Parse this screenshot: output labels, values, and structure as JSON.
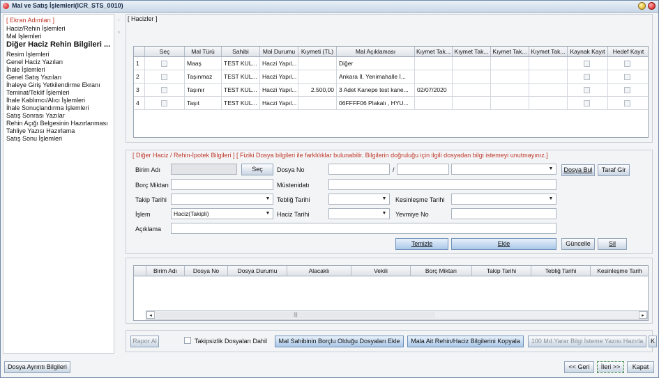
{
  "window": {
    "title": "Mal ve Satış İşlemleri(ICR_STS_0010)"
  },
  "sidebar": {
    "header": "[ Ekran Adımları ]",
    "items": [
      {
        "label": "Haciz/Rehin İşlemleri"
      },
      {
        "label": "Mal İşlemleri"
      },
      {
        "label": "Diğer Haciz Rehin Bilgileri ..."
      },
      {
        "label": "Resim İşlemleri"
      },
      {
        "label": "Genel Haciz Yazıları"
      },
      {
        "label": "İhale İşlemleri"
      },
      {
        "label": "Genel Satış Yazıları"
      },
      {
        "label": "İhaleye Giriş Yetkilendirme Ekranı"
      },
      {
        "label": "Teminat/Teklif İşlemleri"
      },
      {
        "label": "İhale Kablımcı/Alıcı İşlemleri"
      },
      {
        "label": "İhale Sonuçlandırma İşlemleri"
      },
      {
        "label": "Satış Sonrası Yazılar"
      },
      {
        "label": "Rehin Açığı Belgesinin Hazırlanması"
      },
      {
        "label": "Tahliye Yazısı Hazırlama"
      },
      {
        "label": "Satış Sonu İşlemleri"
      }
    ]
  },
  "hacizler": {
    "group_label": "[ Hacizler ]",
    "columns": [
      "",
      "Seç",
      "Mal Türü",
      "Sahibi",
      "Mal Durumu",
      "Kıymeti (TL)",
      "Mal Açıklaması",
      "Kıymet Tak...",
      "Kıymet Tak...",
      "Kıymet Tak...",
      "Kıymet Tak...",
      "Kaynak Kayıt",
      "Hedef Kayıt"
    ],
    "rows": [
      {
        "no": "1",
        "mal_turu": "Maaş",
        "sahibi": "TEST KUL...",
        "mal_durumu": "Haczi Yapıl...",
        "kiymeti": "",
        "aciklama": "Diğer",
        "kt1": ""
      },
      {
        "no": "2",
        "mal_turu": "Taşınmaz",
        "sahibi": "TEST KUL...",
        "mal_durumu": "Haczi Yapıl...",
        "kiymeti": "",
        "aciklama": "Ankara İl, Yenimahalle İ...",
        "kt1": ""
      },
      {
        "no": "3",
        "mal_turu": "Taşınır",
        "sahibi": "TEST KUL...",
        "mal_durumu": "Haczi Yapıl...",
        "kiymeti": "2.500,00",
        "aciklama": "3 Adet Kanepe test kane...",
        "kt1": "02/07/2020"
      },
      {
        "no": "4",
        "mal_turu": "Taşıt",
        "sahibi": "TEST KUL...",
        "mal_durumu": "Haczi Yapıl...",
        "kiymeti": "",
        "aciklama": "06FFFF06 Plakalı , HYU...",
        "kt1": ""
      }
    ]
  },
  "diger_haciz": {
    "group_label": "[ Diğer Haciz / Rehin-İpotek Bilgileri ] [ Fiziki Dosya bilgileri ile farklılıklar bulunabilir. Bilgilerin doğruluğu için ilgili dosyadan bilgi istemeyi unutmayınız.]",
    "birim_adi_label": "Birim Adı",
    "birim_adi_value": "",
    "sec_button": "Seç",
    "dosya_no_label": "Dosya No",
    "dosya_no_value": "",
    "dosya_no_sep": "/",
    "dosya_no_value2": "",
    "dosya_tur_value": "",
    "dosya_bul_button": "Dosya Bul",
    "taraf_gir_button": "Taraf Gir",
    "borc_miktari_label": "Borç Miktarı",
    "borc_miktari_value": "",
    "musteni_label": "Müstenidatı",
    "musteni_value": "",
    "takip_tarihi_label": "Takip Tarihi",
    "takip_tarihi_value": "",
    "teblig_tarihi_label": "Tebliğ Tarihi",
    "teblig_tarihi_value": "",
    "kesinlesme_label": "Kesinleşme Tarihi",
    "kesinlesme_value": "",
    "islem_label": "İşlem",
    "islem_value": "Haciz(Takipli)",
    "haciz_tarihi_label": "Haciz Tarihi",
    "haciz_tarihi_value": "",
    "yevmiye_label": "Yevmiye No",
    "yevmiye_value": "",
    "aciklama_label": "Açıklama",
    "aciklama_value": "",
    "temizle_button": "Temizle",
    "ekle_button": "Ekle",
    "guncelle_button": "Güncelle",
    "sil_button": "Sil"
  },
  "bottom_grid": {
    "columns": [
      "",
      "Birim Adı",
      "Dosya No",
      "Dosya Durumu",
      "Alacaklı",
      "Vekili",
      "Borç Miktarı",
      "Takip Tarihi",
      "Tebliğ Tarihi",
      "Kesinleşme Tarih"
    ],
    "scroll_left": "◂",
    "scroll_right": "▸",
    "scroll_thumb": "|||"
  },
  "actions": {
    "rapor_al": "Rapor Al",
    "takipsizlik_label": "Takipsizlik Dosyaları Dahil",
    "mal_sahibi_button": "Mal Sahibinin Borçlu Olduğu Dosyaları Ekle",
    "mala_ait_button": "Mala Ait Rehin/Haciz Bilgilerini Kopyala",
    "yuz_md_button": "100 Md.Yarar Bilgi İsteme Yazısı Hazırla",
    "extra_button": "K"
  },
  "footer": {
    "dosya_ayrinti": "Dosya Ayrıntı Bilgileri",
    "geri": "<< Geri",
    "ileri": "İleri >>",
    "kapat": "Kapat"
  },
  "icons": {
    "combo": "chevron-down-icon",
    "app": "app-icon"
  }
}
